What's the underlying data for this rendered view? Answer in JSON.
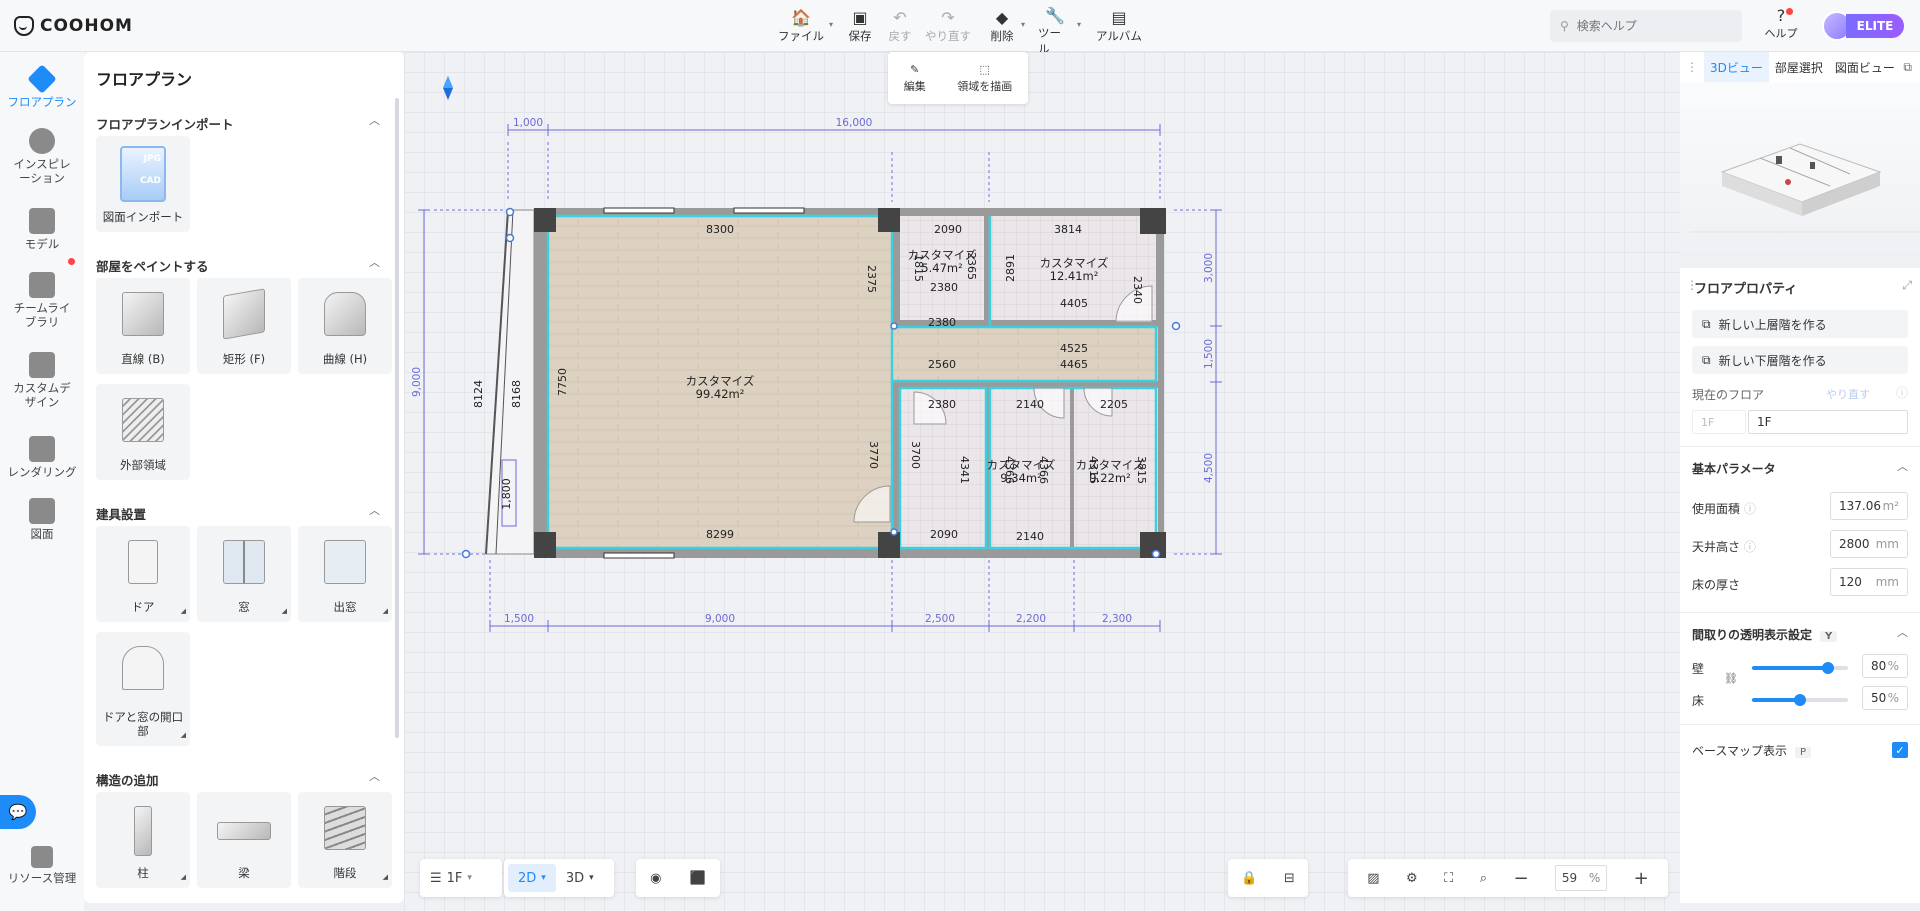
{
  "app": {
    "logo_text": "COOHOM"
  },
  "toolbar": {
    "file": "ファイル",
    "save": "保存",
    "undo": "戻す",
    "redo": "やり直す",
    "delete": "削除",
    "tools": "ツール",
    "album": "アルバム"
  },
  "search": {
    "placeholder": "検索ヘルプ"
  },
  "help": {
    "label": "ヘルプ"
  },
  "plan_badge": "ELITE",
  "leftnav": {
    "items": [
      "フロアプラン",
      "インスピレーション",
      "モデル",
      "チームライブラリ",
      "カスタムデザイン",
      "レンダリング",
      "図面"
    ],
    "resource": "リソース管理"
  },
  "panel": {
    "title": "フロアプラン",
    "sections": [
      {
        "title": "フロアプランインポート",
        "tiles": [
          {
            "label": "図面インポート",
            "badge1": "JPG",
            "badge2": "CAD"
          }
        ]
      },
      {
        "title": "部屋をペイントする",
        "tiles": [
          {
            "label": "直線 (B)"
          },
          {
            "label": "矩形 (F)"
          },
          {
            "label": "曲線 (H)"
          },
          {
            "label": "外部領域"
          }
        ]
      },
      {
        "title": "建具設置",
        "tiles": [
          {
            "label": "ドア"
          },
          {
            "label": "窓"
          },
          {
            "label": "出窓"
          },
          {
            "label": "ドアと窓の開口部"
          }
        ]
      },
      {
        "title": "構造の追加",
        "tiles": [
          {
            "label": "柱"
          },
          {
            "label": "梁"
          },
          {
            "label": "階段"
          }
        ]
      }
    ]
  },
  "canvas_tools": {
    "edit": "編集",
    "draw_area": "領域を描画"
  },
  "floorplan": {
    "rooms": [
      {
        "name": "カスタマイズ",
        "area": "99.42m²"
      },
      {
        "name": "カスタマイズ",
        "area": "5.47m²"
      },
      {
        "name": "カスタマイズ",
        "area": "12.41m²"
      },
      {
        "name": "カスタマイズ",
        "area": "9.34m²"
      },
      {
        "name": "カスタマイズ",
        "area": "9.22m²"
      }
    ],
    "dims_top": [
      "1,000",
      "16,000"
    ],
    "dims_bottom": [
      "1,500",
      "9,000",
      "2,500",
      "2,200",
      "2,300"
    ],
    "dims_left": [
      "9,000"
    ],
    "dims_right": [
      "3,000",
      "1,500",
      "4,500"
    ],
    "inner_dims": [
      "8300",
      "2090",
      "3814",
      "2365",
      "1815",
      "2891",
      "2340",
      "2380",
      "4405",
      "2375",
      "2380",
      "4525",
      "2560",
      "4465",
      "7750",
      "8124",
      "8168",
      "2380",
      "2140",
      "2205",
      "3770",
      "3700",
      "4341",
      "4366",
      "4366",
      "4315",
      "3815",
      "8299",
      "2090",
      "2140",
      "1,800"
    ]
  },
  "bottom": {
    "floor": "1F",
    "mode2d": "2D",
    "mode3d": "3D",
    "zoom": "59",
    "zoom_unit": "%"
  },
  "right": {
    "tabs": [
      "3Dビュー",
      "部屋選択",
      "図面ビュー"
    ],
    "props_title": "フロアプロパティ",
    "new_upper": "新しい上層階を作る",
    "new_lower": "新しい下層階を作る",
    "current_floor_label": "現在のフロア",
    "redo_link": "やり直す",
    "floor_tag": "1F",
    "floor_name": "1F",
    "basic_params": "基本パラメータ",
    "area_label": "使用面積",
    "area_value": "137.06",
    "area_unit": "m²",
    "ceiling_label": "天井高さ",
    "ceiling_value": "2800",
    "ceiling_unit": "mm",
    "floor_thick_label": "床の厚さ",
    "floor_thick_value": "120",
    "floor_thick_unit": "mm",
    "transparency_title": "間取りの透明表示設定",
    "transparency_key": "Y",
    "wall_label": "壁",
    "wall_value": "80",
    "floor_label": "床",
    "floor_value": "50",
    "percent": "%",
    "basemap_label": "ベースマップ表示",
    "basemap_key": "P"
  }
}
